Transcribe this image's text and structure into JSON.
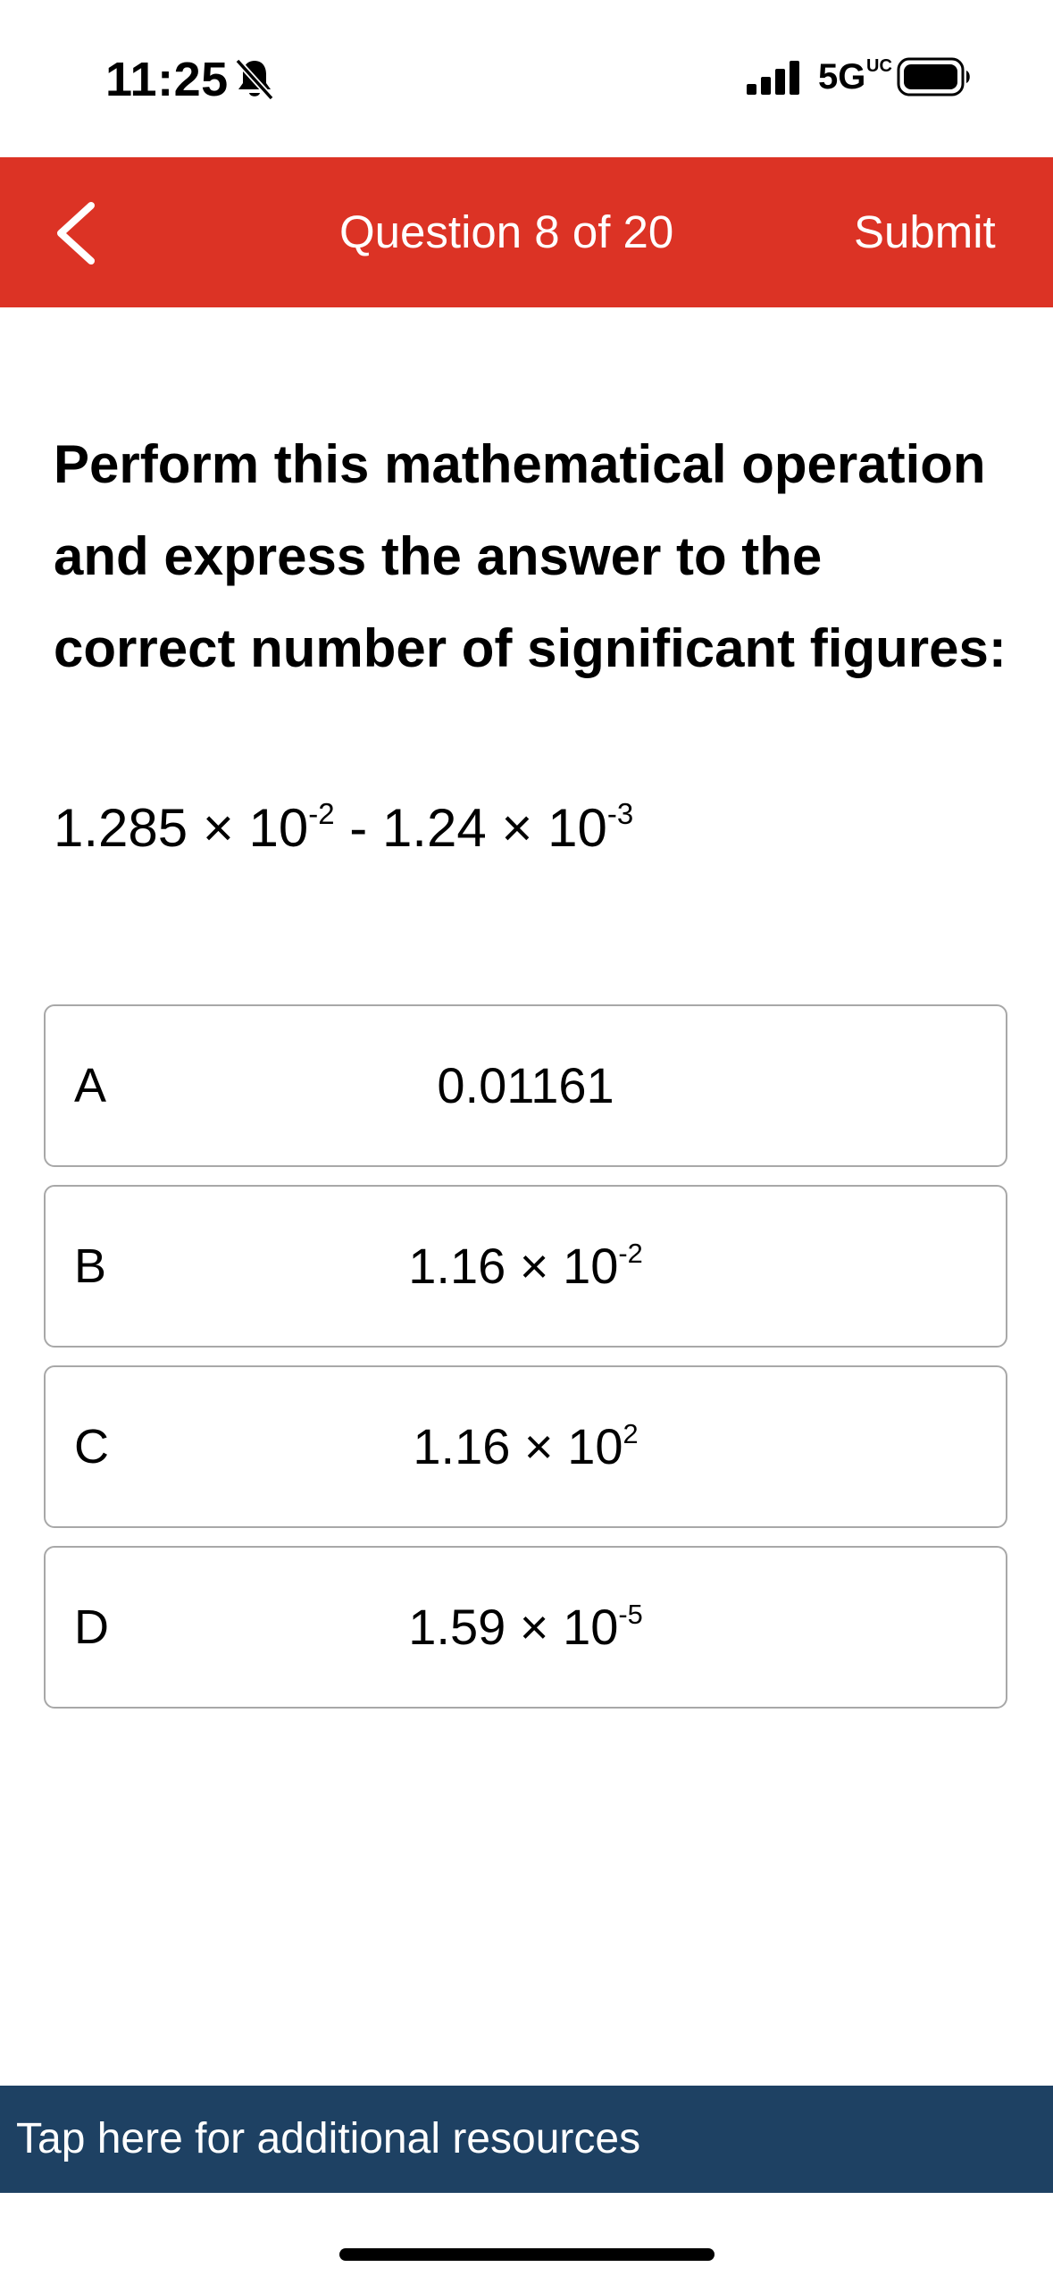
{
  "status_bar": {
    "time": "11:25",
    "network": "5G",
    "network_sub": "UC"
  },
  "header": {
    "title": "Question 8 of 20",
    "submit_label": "Submit",
    "back_icon": "chevron-left-icon"
  },
  "question": {
    "prompt": "Perform this mathematical operation and express the answer to the correct number of significant figures:",
    "expression": {
      "term1_mantissa": "1.285 × 10",
      "term1_exponent": "-2",
      "operator": " - ",
      "term2_mantissa": "1.24 × 10",
      "term2_exponent": "-3"
    }
  },
  "choices": [
    {
      "letter": "A",
      "value": "0.01161",
      "exponent": ""
    },
    {
      "letter": "B",
      "value": "1.16 × 10",
      "exponent": "-2"
    },
    {
      "letter": "C",
      "value": "1.16 × 10",
      "exponent": "2"
    },
    {
      "letter": "D",
      "value": "1.59 × 10",
      "exponent": "-5"
    }
  ],
  "resources": {
    "label": "Tap here for additional resources"
  },
  "colors": {
    "header_bg": "#dc3325",
    "resources_bg": "#1e4163",
    "choice_border": "#a8a8a8"
  }
}
